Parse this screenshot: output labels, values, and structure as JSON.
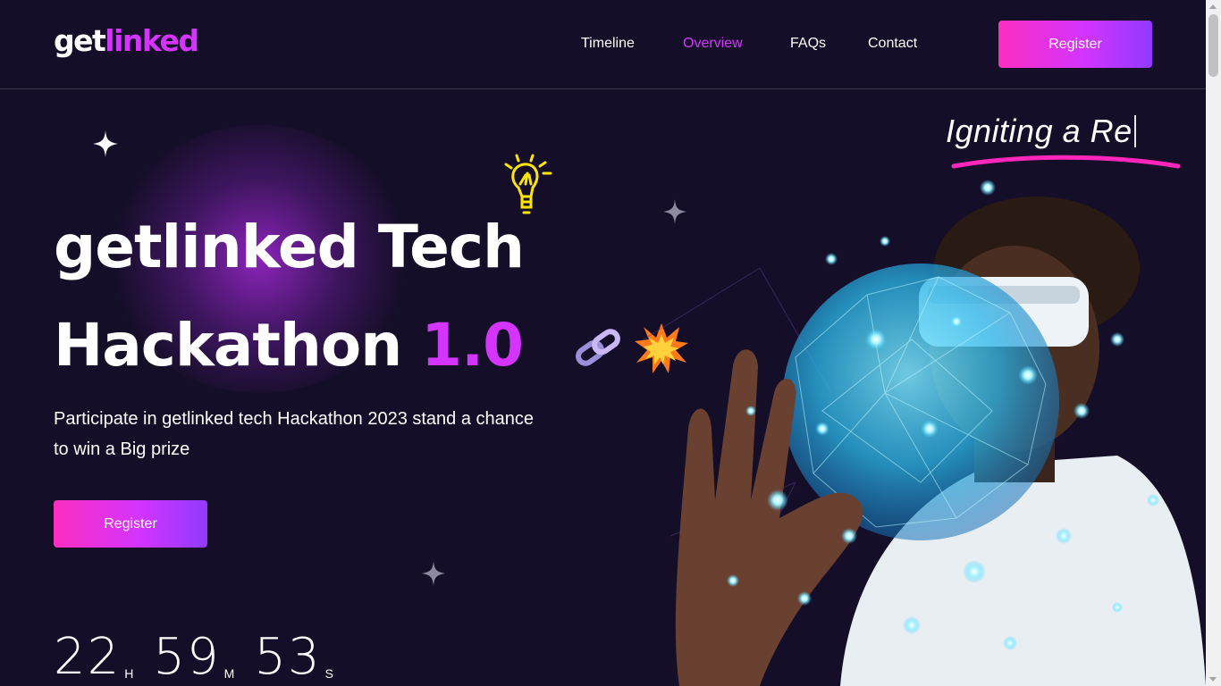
{
  "header": {
    "logo_part1": "get",
    "logo_part2": "linked",
    "nav": [
      {
        "label": "Timeline",
        "active": false
      },
      {
        "label": "Overview",
        "active": true
      },
      {
        "label": "FAQs",
        "active": false
      },
      {
        "label": "Contact",
        "active": false
      }
    ],
    "register_label": "Register"
  },
  "hero": {
    "tagline": "Igniting a Re",
    "title_line1": "getlinked Tech",
    "title_line2_main": "Hackathon ",
    "title_line2_highlight": "1.0",
    "description": "Participate in getlinked tech Hackathon 2023 stand a chance to win a Big prize",
    "register_label": "Register",
    "countdown": {
      "hours": "22",
      "hours_label": "H",
      "minutes": "59",
      "minutes_label": "M",
      "seconds": "53",
      "seconds_label": "S"
    }
  },
  "icons": [
    "star-icon",
    "lightbulb-icon",
    "chain-icon",
    "explosion-icon"
  ],
  "colors": {
    "background": "#150e28",
    "accent": "#d434fe",
    "gradient_start": "#fc2ec0",
    "gradient_end": "#903aff",
    "underline": "#ff26b9"
  }
}
